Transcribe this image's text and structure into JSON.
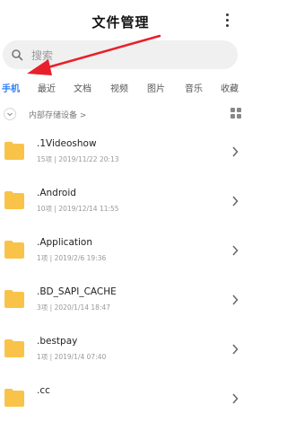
{
  "header": {
    "title": "文件管理"
  },
  "search": {
    "placeholder": "搜索"
  },
  "tabs": [
    {
      "label": "手机",
      "active": true
    },
    {
      "label": "最近"
    },
    {
      "label": "文档"
    },
    {
      "label": "视频"
    },
    {
      "label": "图片"
    },
    {
      "label": "音乐"
    },
    {
      "label": "收藏"
    }
  ],
  "breadcrumb": {
    "label": "内部存储设备 >"
  },
  "files": [
    {
      "name": ".1Videoshow",
      "meta": "15项 | 2019/11/22 20:13"
    },
    {
      "name": ".Android",
      "meta": "10项 | 2019/12/14 11:55"
    },
    {
      "name": ".Application",
      "meta": "1项 | 2019/2/6 19:36"
    },
    {
      "name": ".BD_SAPI_CACHE",
      "meta": "3项 | 2020/1/14 18:47"
    },
    {
      "name": ".bestpay",
      "meta": "1项 | 2019/1/4 07:40"
    },
    {
      "name": ".cc",
      "meta": ""
    }
  ],
  "colors": {
    "accent": "#2f7ff5",
    "folder": "#f9c349",
    "annotation_arrow": "#e8202a"
  }
}
